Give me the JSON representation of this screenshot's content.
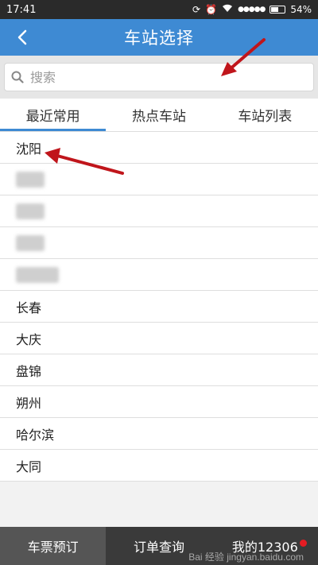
{
  "status_bar": {
    "time": "17:41",
    "signal": "●●●●●",
    "battery_text": "54%"
  },
  "header": {
    "title": "车站选择",
    "back_icon": "chevron-left-icon"
  },
  "search": {
    "placeholder": "搜索",
    "value": ""
  },
  "tabs": [
    {
      "label": "最近常用",
      "active": true
    },
    {
      "label": "热点车站",
      "active": false
    },
    {
      "label": "车站列表",
      "active": false
    }
  ],
  "stations": {
    "first": "沈阳",
    "rest": [
      "长春",
      "大庆",
      "盘锦",
      "朔州",
      "哈尔滨",
      "大同"
    ]
  },
  "bottom_nav": [
    {
      "label": "车票预订",
      "active": true
    },
    {
      "label": "订单查询",
      "active": false
    },
    {
      "label": "我的12306",
      "active": false,
      "badge": true
    }
  ],
  "watermark": "Bai 经验 jingyan.baidu.com",
  "colors": {
    "primary": "#3e8ad3",
    "arrow": "#c0151b",
    "badge": "#e51c23"
  }
}
